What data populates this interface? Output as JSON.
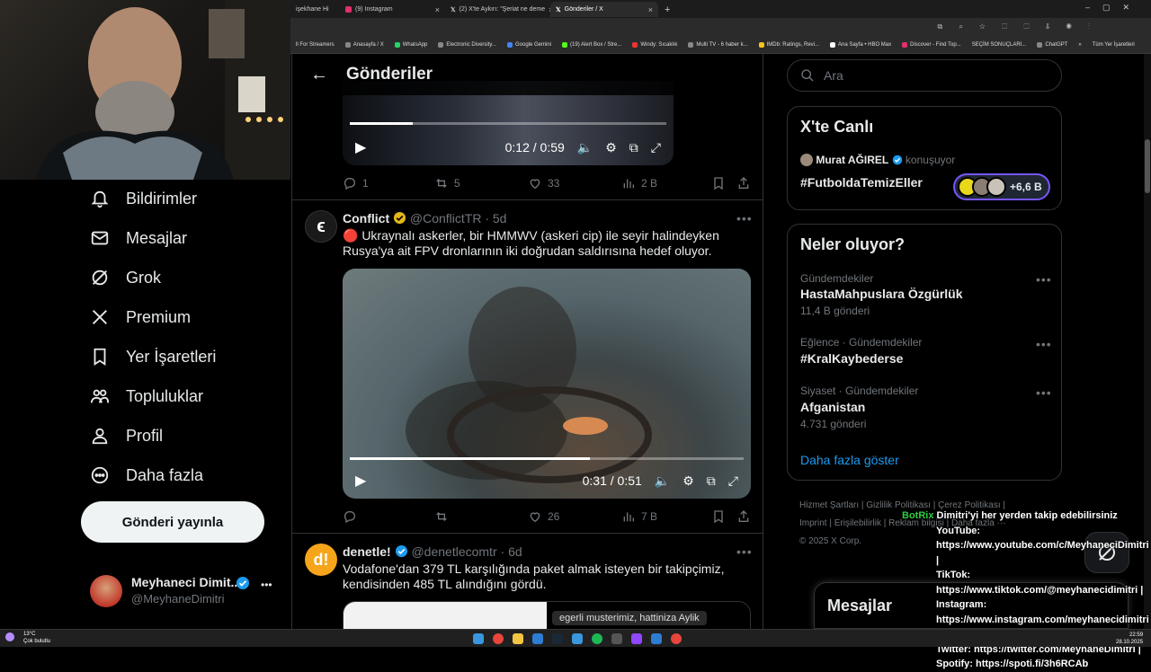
{
  "browser": {
    "tabs": [
      {
        "label": "işekhane Hi"
      },
      {
        "label": "(9) Instagram"
      },
      {
        "label": "(2) X'te Aykırı: \"Şeriat ne deme"
      },
      {
        "label": "Gönderiler / X"
      }
    ],
    "new_tab": "+",
    "bookmarks": [
      "ll For Streamers",
      "Anasayfa / X",
      "WhatsApp",
      "Electronic Diversity...",
      "Google Gemini",
      "(19) Alert Box / Stre...",
      "Windy: Sıcaklık",
      "Multi TV - 6 haber k...",
      "IMDb: Ratings, Revi...",
      "Ana Sayfa • HBO Max",
      "Discover - Find Top...",
      "SEÇİM SONUÇLARI...",
      "ChatGPT",
      "»",
      "Tüm Yer İşaretleri"
    ]
  },
  "sidebar": {
    "items": [
      {
        "label": "Bildirimler",
        "icon": "bell-icon"
      },
      {
        "label": "Mesajlar",
        "icon": "mail-icon"
      },
      {
        "label": "Grok",
        "icon": "grok-icon"
      },
      {
        "label": "Premium",
        "icon": "x-logo-icon"
      },
      {
        "label": "Yer İşaretleri",
        "icon": "bookmark-icon"
      },
      {
        "label": "Topluluklar",
        "icon": "people-icon"
      },
      {
        "label": "Profil",
        "icon": "person-icon"
      },
      {
        "label": "Daha fazla",
        "icon": "more-circle-icon"
      }
    ],
    "post_button": "Gönderi yayınla",
    "account": {
      "name": "Meyhaneci Dimit...",
      "handle": "@MeyhaneDimitri",
      "more": "•••"
    }
  },
  "main": {
    "header_title": "Gönderiler",
    "tweet1": {
      "video_time": "0:12 / 0:59",
      "video_progress": 0.2,
      "stats": {
        "replies": "1",
        "reposts": "5",
        "likes": "33",
        "views": "2 B"
      }
    },
    "tweet2": {
      "author": "Conflict",
      "handle": "@ConflictTR",
      "age": "· 5d",
      "text": "🔴 Ukraynalı askerler, bir HMMWV (askeri cip) ile seyir halindeyken Rusya'ya ait FPV dronlarının iki doğrudan saldırısına hedef oluyor.",
      "video_time": "0:31 / 0:51",
      "video_progress": 0.61,
      "stats": {
        "replies": "",
        "reposts": "",
        "likes": "26",
        "views": "7 B"
      },
      "more": "•••"
    },
    "tweet3": {
      "author": "denetle!",
      "handle": "@denetlecomtr",
      "age": "· 6d",
      "text": "Vodafone'dan 379 TL karşılığında paket almak isteyen bir takipçimiz, kendisinden 485 TL alındığını gördü.",
      "image_text": "egerli musterimiz, hattiniza Aylik",
      "more": "•••"
    }
  },
  "right": {
    "search_placeholder": "Ara",
    "live": {
      "title": "X'te Canlı",
      "host": "Murat AĞIREL",
      "status": "konuşuyor",
      "topic": "#FutboldaTemizEller",
      "listeners": "+6,6 B"
    },
    "trends": {
      "title": "Neler oluyor?",
      "items": [
        {
          "category": "Gündemdekiler",
          "name": "HastaMahpuslara Özgürlük",
          "count": "11,4 B gönderi"
        },
        {
          "category": "Eğlence · Gündemdekiler",
          "name": "#KralKaybederse",
          "count": ""
        },
        {
          "category": "Siyaset · Gündemdekiler",
          "name": "Afganistan",
          "count": "4.731 gönderi"
        }
      ],
      "show_more": "Daha fazla göster"
    },
    "footer": {
      "links": [
        "Hizmet Şartları",
        "Gizlilik Politikası",
        "Çerez Politikası",
        "Imprint",
        "Erişilebilirlik",
        "Reklam bilgisi",
        "Daha fazla ···"
      ],
      "copyright": "© 2025 X Corp."
    },
    "messages_label": "Mesajlar"
  },
  "chat_overlay": {
    "bot": "BotRix",
    "lines": [
      "Dimitri'yi her yerden takip edebilirsiniz",
      "YouTube:",
      "https://www.youtube.com/c/MeyhaneciDimitri |",
      "TikTok:",
      "https://www.tiktok.com/@meyhanecidimitri |",
      "Instagram:",
      "https://www.instagram.com/meyhanecidimitri |",
      "Twitter: https://twitter.com/MeyhaneDimitri |",
      "Spotify: https://spoti.fi/3h6RCAb"
    ]
  },
  "taskbar": {
    "weather_temp": "13°C",
    "weather_desc": "Çok bulutlu",
    "time": "22:59",
    "date": "28.10.2025"
  },
  "colors": {
    "accent": "#1d9bf0",
    "verified_gold": "#e2b719",
    "bot_green": "#2ecc40"
  }
}
